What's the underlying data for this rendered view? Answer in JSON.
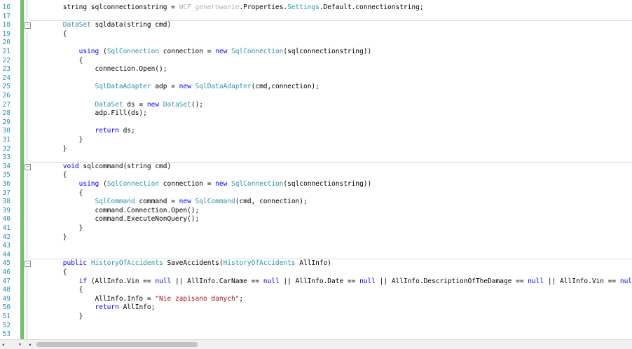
{
  "editor": {
    "lines": [
      {
        "n": "16",
        "parts": [
          {
            "t": "        string sqlconnectionstring = ",
            "c": ""
          },
          {
            "t": "WCF_generowanie",
            "c": "gray"
          },
          {
            "t": ".Properties.",
            "c": ""
          },
          {
            "t": "Settings",
            "c": "ty"
          },
          {
            "t": ".Default.connectionstring;",
            "c": ""
          }
        ]
      },
      {
        "n": "17",
        "parts": []
      },
      {
        "n": "18",
        "parts": [
          {
            "t": "        DataSet",
            "c": "ty"
          },
          {
            "t": " sqldata(string cmd)",
            "c": ""
          }
        ]
      },
      {
        "n": "19",
        "parts": [
          {
            "t": "        {",
            "c": ""
          }
        ]
      },
      {
        "n": "20",
        "parts": []
      },
      {
        "n": "21",
        "parts": [
          {
            "t": "            ",
            "c": ""
          },
          {
            "t": "using",
            "c": "kw"
          },
          {
            "t": " (",
            "c": ""
          },
          {
            "t": "SqlConnection",
            "c": "ty"
          },
          {
            "t": " connection = ",
            "c": ""
          },
          {
            "t": "new",
            "c": "kw"
          },
          {
            "t": " ",
            "c": ""
          },
          {
            "t": "SqlConnection",
            "c": "ty"
          },
          {
            "t": "(sqlconnectionstring))",
            "c": ""
          }
        ]
      },
      {
        "n": "22",
        "parts": [
          {
            "t": "            {",
            "c": ""
          }
        ]
      },
      {
        "n": "23",
        "parts": [
          {
            "t": "                connection.Open();",
            "c": ""
          }
        ]
      },
      {
        "n": "24",
        "parts": []
      },
      {
        "n": "25",
        "parts": [
          {
            "t": "                ",
            "c": ""
          },
          {
            "t": "SqlDataAdapter",
            "c": "ty"
          },
          {
            "t": " adp = ",
            "c": ""
          },
          {
            "t": "new",
            "c": "kw"
          },
          {
            "t": " ",
            "c": ""
          },
          {
            "t": "SqlDataAdapter",
            "c": "ty"
          },
          {
            "t": "(cmd,connection);",
            "c": ""
          }
        ]
      },
      {
        "n": "26",
        "parts": []
      },
      {
        "n": "27",
        "parts": [
          {
            "t": "                ",
            "c": ""
          },
          {
            "t": "DataSet",
            "c": "ty"
          },
          {
            "t": " ds = ",
            "c": ""
          },
          {
            "t": "new",
            "c": "kw"
          },
          {
            "t": " ",
            "c": ""
          },
          {
            "t": "DataSet",
            "c": "ty"
          },
          {
            "t": "();",
            "c": ""
          }
        ]
      },
      {
        "n": "28",
        "parts": [
          {
            "t": "                adp.Fill(ds);",
            "c": ""
          }
        ]
      },
      {
        "n": "29",
        "parts": []
      },
      {
        "n": "30",
        "parts": [
          {
            "t": "                ",
            "c": ""
          },
          {
            "t": "return",
            "c": "kw"
          },
          {
            "t": " ds;",
            "c": ""
          }
        ]
      },
      {
        "n": "31",
        "parts": [
          {
            "t": "            }",
            "c": ""
          }
        ]
      },
      {
        "n": "32",
        "parts": [
          {
            "t": "        }",
            "c": ""
          }
        ]
      },
      {
        "n": "33",
        "parts": []
      },
      {
        "n": "34",
        "parts": [
          {
            "t": "        ",
            "c": ""
          },
          {
            "t": "void",
            "c": "kw"
          },
          {
            "t": " sqlcommand(string cmd)",
            "c": ""
          }
        ]
      },
      {
        "n": "35",
        "parts": [
          {
            "t": "        {",
            "c": ""
          }
        ]
      },
      {
        "n": "36",
        "parts": [
          {
            "t": "            ",
            "c": ""
          },
          {
            "t": "using",
            "c": "kw"
          },
          {
            "t": " (",
            "c": ""
          },
          {
            "t": "SqlConnection",
            "c": "ty"
          },
          {
            "t": " connection = ",
            "c": ""
          },
          {
            "t": "new",
            "c": "kw"
          },
          {
            "t": " ",
            "c": ""
          },
          {
            "t": "SqlConnection",
            "c": "ty"
          },
          {
            "t": "(sqlconnectionstring))",
            "c": ""
          }
        ]
      },
      {
        "n": "37",
        "parts": [
          {
            "t": "            {",
            "c": ""
          }
        ]
      },
      {
        "n": "38",
        "parts": [
          {
            "t": "                ",
            "c": ""
          },
          {
            "t": "SqlCommand",
            "c": "ty"
          },
          {
            "t": " command = ",
            "c": ""
          },
          {
            "t": "new",
            "c": "kw"
          },
          {
            "t": " ",
            "c": ""
          },
          {
            "t": "SqlCommand",
            "c": "ty"
          },
          {
            "t": "(cmd, connection);",
            "c": ""
          }
        ]
      },
      {
        "n": "39",
        "parts": [
          {
            "t": "                command.Connection.Open();",
            "c": ""
          }
        ]
      },
      {
        "n": "40",
        "parts": [
          {
            "t": "                command.ExecuteNonQuery();",
            "c": ""
          }
        ]
      },
      {
        "n": "41",
        "parts": [
          {
            "t": "            }",
            "c": ""
          }
        ]
      },
      {
        "n": "42",
        "parts": [
          {
            "t": "        }",
            "c": ""
          }
        ]
      },
      {
        "n": "43",
        "parts": []
      },
      {
        "n": "44",
        "parts": []
      },
      {
        "n": "45",
        "parts": [
          {
            "t": "        ",
            "c": ""
          },
          {
            "t": "public",
            "c": "kw"
          },
          {
            "t": " ",
            "c": ""
          },
          {
            "t": "HistoryOfAccidents",
            "c": "ty"
          },
          {
            "t": " SaveAccidents(",
            "c": ""
          },
          {
            "t": "HistoryOfAccidents",
            "c": "ty"
          },
          {
            "t": " AllInfo)",
            "c": ""
          }
        ]
      },
      {
        "n": "46",
        "parts": [
          {
            "t": "        {",
            "c": ""
          }
        ]
      },
      {
        "n": "47",
        "parts": [
          {
            "t": "            ",
            "c": ""
          },
          {
            "t": "if",
            "c": "kw"
          },
          {
            "t": " (AllInfo.Vin == ",
            "c": ""
          },
          {
            "t": "null",
            "c": "kw"
          },
          {
            "t": " || AllInfo.CarName == ",
            "c": ""
          },
          {
            "t": "null",
            "c": "kw"
          },
          {
            "t": " || AllInfo.Date == ",
            "c": ""
          },
          {
            "t": "null",
            "c": "kw"
          },
          {
            "t": " || AllInfo.DescriptionOfTheDamage == ",
            "c": ""
          },
          {
            "t": "null",
            "c": "kw"
          },
          {
            "t": " || AllInfo.Vin == ",
            "c": ""
          },
          {
            "t": "null",
            "c": "kw"
          },
          {
            "t": " )",
            "c": ""
          }
        ]
      },
      {
        "n": "48",
        "parts": [
          {
            "t": "            {",
            "c": ""
          }
        ]
      },
      {
        "n": "49",
        "parts": [
          {
            "t": "                AllInfo.Info = ",
            "c": ""
          },
          {
            "t": "\"Nie zapisano danych\"",
            "c": "str"
          },
          {
            "t": ";",
            "c": ""
          }
        ]
      },
      {
        "n": "50",
        "parts": [
          {
            "t": "                ",
            "c": ""
          },
          {
            "t": "return",
            "c": "kw"
          },
          {
            "t": " AllInfo;",
            "c": ""
          }
        ]
      },
      {
        "n": "51",
        "parts": [
          {
            "t": "            }",
            "c": ""
          }
        ]
      },
      {
        "n": "52",
        "parts": []
      },
      {
        "n": "53",
        "parts": []
      }
    ],
    "fold_markers": [
      "18",
      "34",
      "45"
    ]
  },
  "scrollbar": {
    "left_arrow": "◂",
    "dropdown": "▾",
    "left_arrow2": "◂"
  }
}
